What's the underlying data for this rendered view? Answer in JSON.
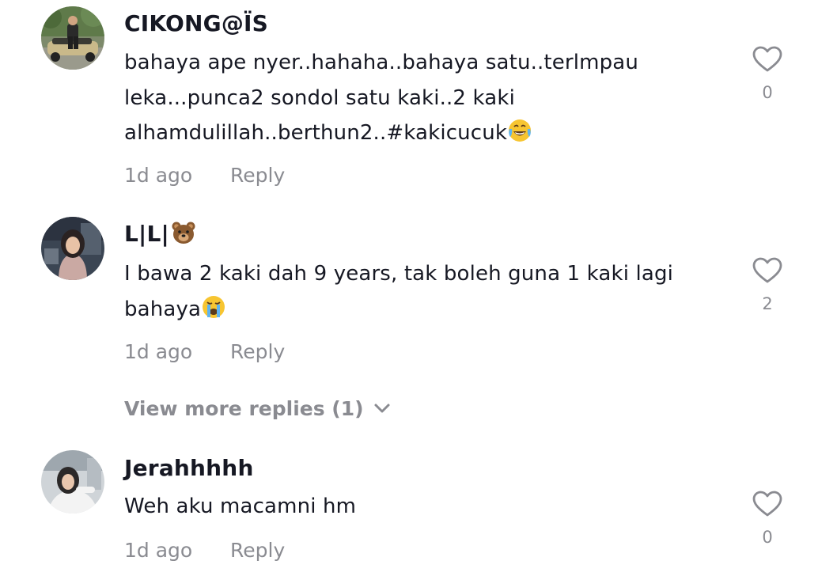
{
  "comments": [
    {
      "username": "CIKONG@ÏS",
      "text": "bahaya ape nyer..hahaha..bahaya satu..terlmpau leka...punca2 sondol satu kaki..2 kaki alhamdulillah..berthun2..#kakicucuk",
      "text_emoji": "face-with-tears-of-joy-emoji",
      "time": "1d ago",
      "reply_label": "Reply",
      "likes": "0",
      "avatar_icon": "man-on-car-avatar"
    },
    {
      "username": "L|L|",
      "username_emoji": "bear-face-emoji",
      "text": "I bawa 2 kaki dah 9 years, tak boleh guna 1 kaki lagi bahaya",
      "text_emoji": "loudly-crying-face-emoji",
      "time": "1d ago",
      "reply_label": "Reply",
      "likes": "2",
      "avatar_icon": "woman-in-hijab-avatar"
    },
    {
      "username": "Jerahhhhh",
      "text": "Weh aku macamni hm",
      "time": "1d ago",
      "reply_label": "Reply",
      "likes": "0",
      "avatar_icon": "woman-in-hijab-avatar"
    }
  ],
  "view_more": {
    "label": "View more replies (1)",
    "icon": "chevron-down-icon"
  },
  "colors": {
    "text_primary": "#161823",
    "text_secondary": "#8a8b91",
    "background": "#ffffff"
  }
}
